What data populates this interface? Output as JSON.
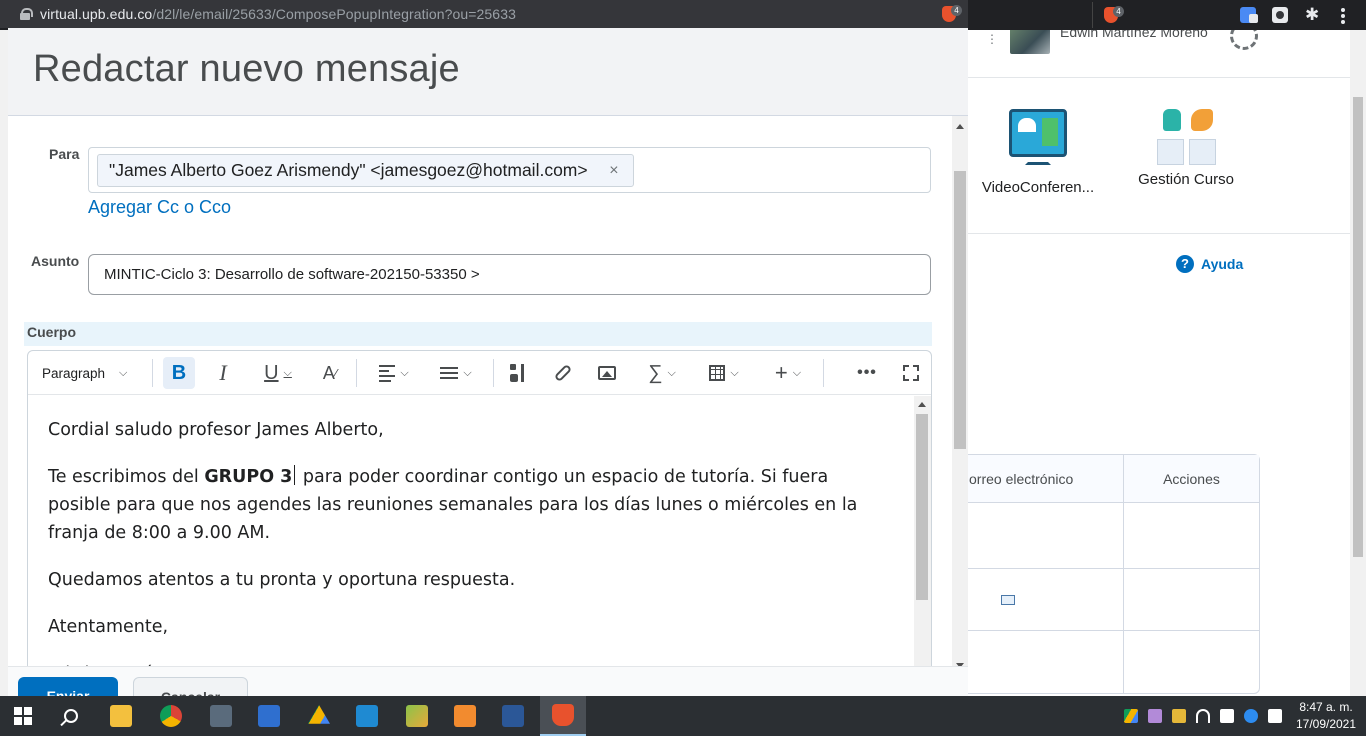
{
  "browser": {
    "url_host": "virtual.upb.edu.co",
    "url_path": "/d2l/le/email/25633/ComposePopupIntegration?ou=25633",
    "brave_count": "4"
  },
  "background": {
    "username": "Edwin Martínez Moreno",
    "tiles": [
      {
        "label": "VideoConferen...",
        "icon": "videoconference-icon"
      },
      {
        "label": "Gestión Curso",
        "icon": "course-management-icon"
      }
    ],
    "help_label": "Ayuda",
    "table": {
      "col_email": "orreo electrónico",
      "col_actions": "Acciones"
    }
  },
  "compose": {
    "title": "Redactar nuevo mensaje",
    "to_label": "Para",
    "recipient": "\"James Alberto Goez Arismendy\" <jamesgoez@hotmail.com>",
    "remove_symbol": "×",
    "add_cc": "Agregar Cc o Cco",
    "subject_label": "Asunto",
    "subject_value": "MINTIC-Ciclo 3: Desarrollo de software-202150-53350 >",
    "body_label": "Cuerpo",
    "toolbar": {
      "format": "Paragraph",
      "bold": "B",
      "italic": "I",
      "underline": "U",
      "sigma": "∑",
      "plus": "+",
      "more": "•••"
    },
    "body": {
      "p1": "Cordial saludo profesor James Alberto,",
      "p2_before": "Te escribimos del ",
      "p2_bold": "GRUPO 3",
      "p2_after": " para poder coordinar contigo un espacio de tutoría. Si fuera posible para que nos agendes las reuniones semanales para los días lunes o miércoles en la franja de 8:00 a 9.00 AM.",
      "p3": "Quedamos atentos a tu pronta y oportuna respuesta.",
      "p4": "Atentamente,",
      "p5": "Edwin Martínez"
    },
    "buttons": {
      "send": "Enviar",
      "cancel": "Cancelar"
    }
  },
  "taskbar": {
    "time": "8:47 a. m.",
    "date": "17/09/2021"
  },
  "colors": {
    "accent": "#006fbf",
    "taskbar": "#2b2f33"
  }
}
